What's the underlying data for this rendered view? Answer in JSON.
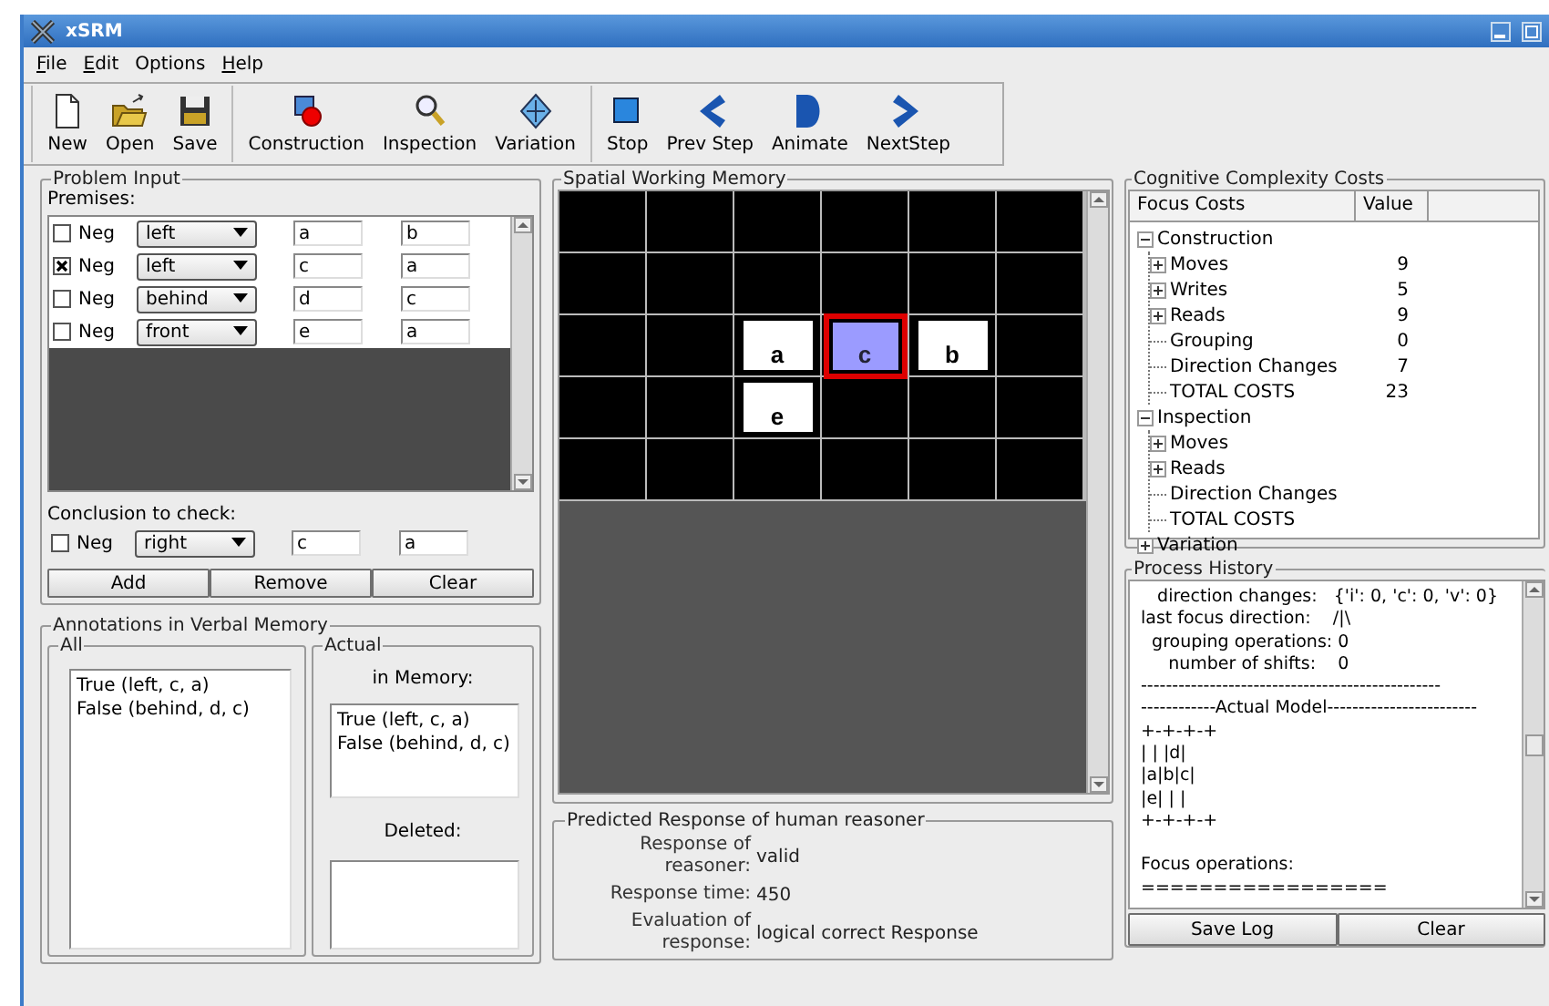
{
  "window": {
    "title": "xSRM"
  },
  "menu": [
    {
      "label": "File",
      "mnemonic": true
    },
    {
      "label": "Edit",
      "mnemonic": true
    },
    {
      "label": "Options",
      "mnemonic": false
    },
    {
      "label": "Help",
      "mnemonic": true
    }
  ],
  "toolbar": [
    [
      {
        "label": "New"
      },
      {
        "label": "Open"
      },
      {
        "label": "Save"
      }
    ],
    [
      {
        "label": "Construction"
      },
      {
        "label": "Inspection"
      },
      {
        "label": "Variation"
      }
    ],
    [
      {
        "label": "Stop"
      },
      {
        "label": "Prev Step"
      },
      {
        "label": "Animate"
      },
      {
        "label": "NextStep"
      }
    ]
  ],
  "problem_input": {
    "title": "Problem Input",
    "premises_label": "Premises:",
    "premises": [
      {
        "neg_label": "Neg",
        "negated": false,
        "relation": "left",
        "first": "a",
        "second": "b"
      },
      {
        "neg_label": "Neg",
        "negated": true,
        "relation": "left",
        "first": "c",
        "second": "a"
      },
      {
        "neg_label": "Neg",
        "negated": false,
        "relation": "behind",
        "first": "d",
        "second": "c"
      },
      {
        "neg_label": "Neg",
        "negated": false,
        "relation": "front",
        "first": "e",
        "second": "a"
      }
    ],
    "conclusion_label": "Conclusion to check:",
    "conclusion": {
      "neg_label": "Neg",
      "negated": false,
      "relation": "right",
      "first": "c",
      "second": "a"
    },
    "buttons": [
      "Add",
      "Remove",
      "Clear"
    ]
  },
  "annotations": {
    "title": "Annotations in Verbal Memory",
    "all": {
      "title": "All",
      "items": [
        "True (left, c, a)",
        "False (behind, d, c)"
      ]
    },
    "actual": {
      "title": "Actual",
      "in_memory_label": "in Memory:",
      "in_memory": [
        "True (left, c, a)",
        "False (behind, d, c)"
      ],
      "deleted_label": "Deleted:"
    }
  },
  "spatial_memory": {
    "title": "Spatial Working Memory",
    "grid": [
      [
        {
          "kind": "empty"
        },
        {
          "kind": "empty"
        },
        {
          "kind": "empty"
        },
        {
          "kind": "empty"
        },
        {
          "kind": "empty"
        },
        {
          "kind": "empty"
        }
      ],
      [
        {
          "kind": "empty"
        },
        {
          "kind": "empty"
        },
        {
          "kind": "empty"
        },
        {
          "kind": "empty"
        },
        {
          "kind": "empty"
        },
        {
          "kind": "empty"
        }
      ],
      [
        {
          "kind": "empty"
        },
        {
          "kind": "empty"
        },
        {
          "kind": "tile",
          "label": "a",
          "focused": false
        },
        {
          "kind": "tile",
          "label": "c",
          "focused": true
        },
        {
          "kind": "tile",
          "label": "b",
          "focused": false
        },
        {
          "kind": "empty"
        }
      ],
      [
        {
          "kind": "empty"
        },
        {
          "kind": "empty"
        },
        {
          "kind": "tile",
          "label": "e",
          "focused": false
        },
        {
          "kind": "empty"
        },
        {
          "kind": "empty"
        },
        {
          "kind": "empty"
        }
      ],
      [
        {
          "kind": "empty"
        },
        {
          "kind": "empty"
        },
        {
          "kind": "empty"
        },
        {
          "kind": "empty"
        },
        {
          "kind": "empty"
        },
        {
          "kind": "empty"
        }
      ]
    ]
  },
  "predicted_response": {
    "title": "Predicted Response of human reasoner",
    "rows": [
      {
        "label": "Response of reasoner:",
        "value": "valid"
      },
      {
        "label": "Response time:",
        "value": "450"
      },
      {
        "label": "Evaluation of response:",
        "value": "logical correct Response"
      }
    ]
  },
  "complexity_costs": {
    "title": "Cognitive Complexity Costs",
    "columns": [
      "Focus Costs",
      "Value"
    ],
    "tree": [
      {
        "label": "Construction",
        "expanded": true,
        "children": [
          {
            "label": "Moves",
            "value": "9",
            "expanded": false
          },
          {
            "label": "Writes",
            "value": "5",
            "expanded": false
          },
          {
            "label": "Reads",
            "value": "9",
            "expanded": false
          },
          {
            "label": "Grouping",
            "value": "0"
          },
          {
            "label": "Direction Changes",
            "value": "7"
          },
          {
            "label": "TOTAL COSTS",
            "value": "23"
          }
        ]
      },
      {
        "label": "Inspection",
        "expanded": true,
        "children": [
          {
            "label": "Moves",
            "expanded": false
          },
          {
            "label": "Reads",
            "expanded": false
          },
          {
            "label": "Direction Changes"
          },
          {
            "label": "TOTAL COSTS"
          }
        ]
      },
      {
        "label": "Variation",
        "expanded": false
      }
    ]
  },
  "process_history": {
    "title": "Process History",
    "blocks": [
      [
        "   direction changes:   {'i': 0, 'c': 0, 'v': 0}",
        "last focus direction:    /|\\",
        "  grouping operations: 0",
        "     number of shifts:    0",
        "------------------------------------------------",
        "------------Actual Model------------------------",
        "+-+-+-+",
        "| | |d|",
        "|a|b|c|",
        "|e| | |",
        "+-+-+-+"
      ],
      [
        "Focus operations:",
        "================="
      ]
    ],
    "buttons": [
      "Save Log",
      "Clear"
    ]
  }
}
